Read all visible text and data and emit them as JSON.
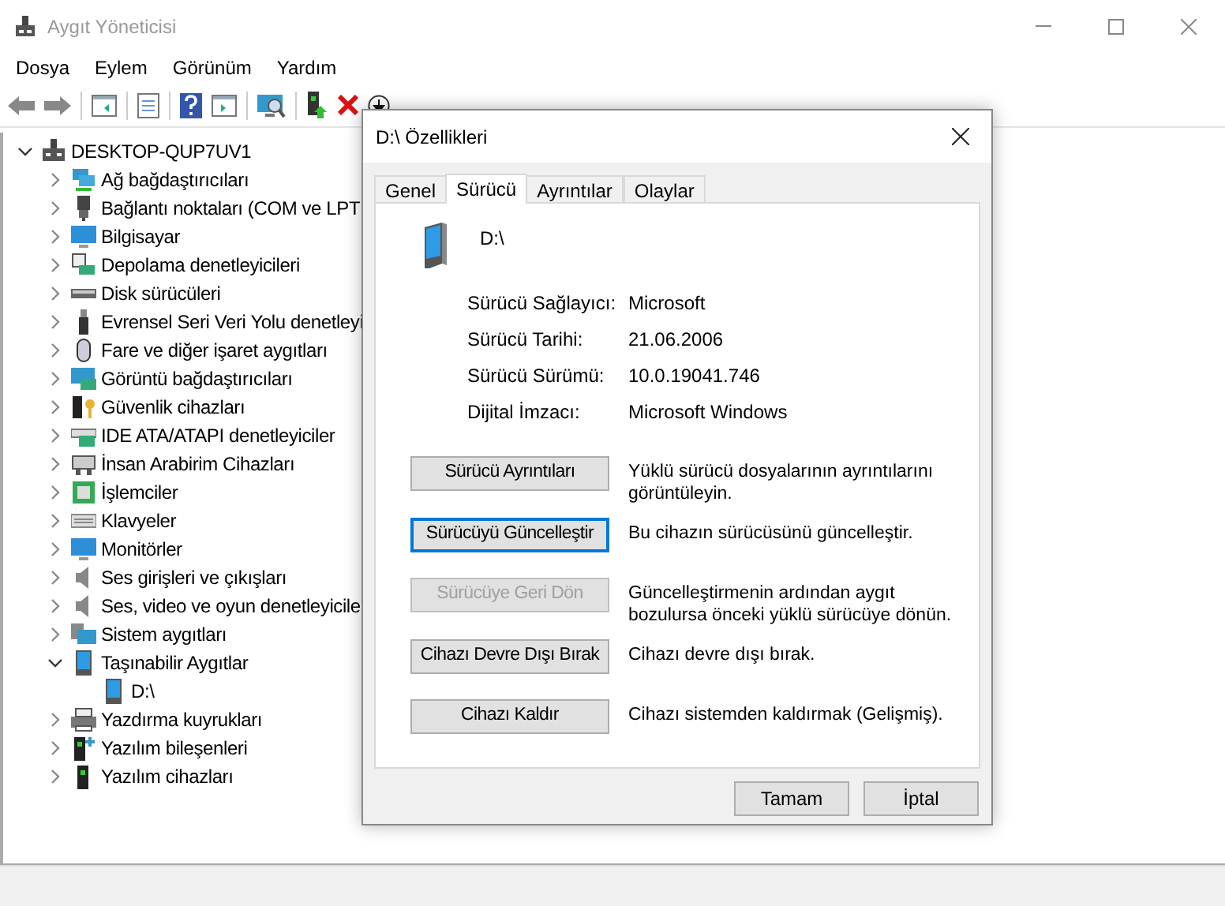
{
  "window": {
    "title": "Aygıt Yöneticisi"
  },
  "menu": [
    "Dosya",
    "Eylem",
    "Görünüm",
    "Yardım"
  ],
  "tree": {
    "label": "DESKTOP-QUP7UV1",
    "expanded": true,
    "children": [
      {
        "label": "Ağ bağdaştırıcıları",
        "expanded": false
      },
      {
        "label": "Bağlantı noktaları (COM ve LPT",
        "expanded": false
      },
      {
        "label": "Bilgisayar",
        "expanded": false
      },
      {
        "label": "Depolama denetleyicileri",
        "expanded": false
      },
      {
        "label": "Disk sürücüleri",
        "expanded": false
      },
      {
        "label": "Evrensel Seri Veri Yolu denetleyi",
        "expanded": false
      },
      {
        "label": "Fare ve diğer işaret aygıtları",
        "expanded": false
      },
      {
        "label": "Görüntü bağdaştırıcıları",
        "expanded": false
      },
      {
        "label": "Güvenlik cihazları",
        "expanded": false
      },
      {
        "label": "IDE ATA/ATAPI denetleyiciler",
        "expanded": false
      },
      {
        "label": "İnsan Arabirim Cihazları",
        "expanded": false
      },
      {
        "label": "İşlemciler",
        "expanded": false
      },
      {
        "label": "Klavyeler",
        "expanded": false
      },
      {
        "label": "Monitörler",
        "expanded": false
      },
      {
        "label": "Ses girişleri ve çıkışları",
        "expanded": false
      },
      {
        "label": "Ses, video ve oyun denetleyicile",
        "expanded": false
      },
      {
        "label": "Sistem aygıtları",
        "expanded": false
      },
      {
        "label": "Taşınabilir Aygıtlar",
        "expanded": true,
        "children": [
          {
            "label": "D:\\"
          }
        ]
      },
      {
        "label": "Yazdırma kuyrukları",
        "expanded": false
      },
      {
        "label": "Yazılım bileşenleri",
        "expanded": false
      },
      {
        "label": "Yazılım cihazları",
        "expanded": false
      }
    ]
  },
  "dialog": {
    "title": "D:\\ Özellikleri",
    "tabs": [
      {
        "label": "Genel",
        "selected": false
      },
      {
        "label": "Sürücü",
        "selected": true
      },
      {
        "label": "Ayrıntılar",
        "selected": false
      },
      {
        "label": "Olaylar",
        "selected": false
      }
    ],
    "device_name": "D:\\",
    "properties": [
      {
        "label": "Sürücü Sağlayıcı:",
        "value": "Microsoft"
      },
      {
        "label": "Sürücü Tarihi:",
        "value": "21.06.2006"
      },
      {
        "label": "Sürücü Sürümü:",
        "value": "10.0.19041.746"
      },
      {
        "label": "Dijital İmzacı:",
        "value": "Microsoft Windows"
      }
    ],
    "actions": [
      {
        "button": "Sürücü Ayrıntıları",
        "description": "Yüklü sürücü dosyalarının ayrıntılarını görüntüleyin.",
        "disabled": false,
        "focused": false
      },
      {
        "button": "Sürücüyü Güncelleştir",
        "description": "Bu cihazın sürücüsünü güncelleştir.",
        "disabled": false,
        "focused": true
      },
      {
        "button": "Sürücüye Geri Dön",
        "description": "Güncelleştirmenin ardından aygıt bozulursa önceki yüklü sürücüye dönün.",
        "disabled": true,
        "focused": false
      },
      {
        "button": "Cihazı Devre Dışı Bırak",
        "description": "Cihazı devre dışı bırak.",
        "disabled": false,
        "focused": false
      },
      {
        "button": "Cihazı Kaldır",
        "description": "Cihazı sistemden kaldırmak (Gelişmiş).",
        "disabled": false,
        "focused": false
      }
    ],
    "buttons": [
      "Tamam",
      "İptal"
    ]
  }
}
